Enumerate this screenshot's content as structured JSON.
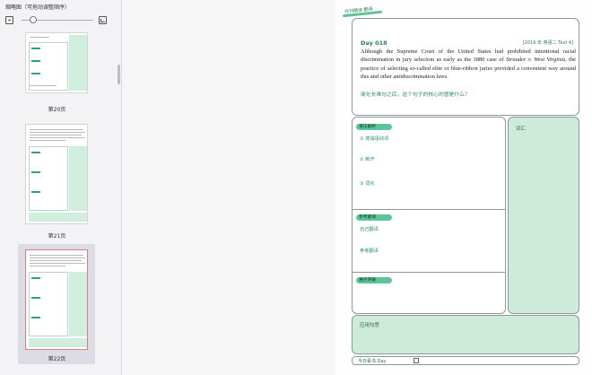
{
  "panel": {
    "title": "缩略图（可拖动调整顺序）"
  },
  "thumbnails": [
    {
      "label": "第20页",
      "selected": false
    },
    {
      "label": "第21页",
      "selected": false
    },
    {
      "label": "第22页",
      "selected": true
    }
  ],
  "document": {
    "logo_text": "外刊精读·翻译",
    "day_label": "Day 018",
    "source": "[2016 年 英语二 Text 4]",
    "english_sentence_parts": [
      "Although the Supreme Court of the United States had prohibited intentional racial discrimination in jury selection as early as the 1880 case of ",
      "Strauder v. West Virginia",
      ", the practice of selecting so-called elite or blue-ribbon juries provided a convenient way around this and other antidiscrimination laws."
    ],
    "question": "简化长难句之后，这个句子的核心的冒是什么？",
    "sections": {
      "analysis_tag": "语法解析",
      "analysis_items": [
        "① 简谓语动词",
        "② 断开",
        "③ 词化"
      ],
      "translation_tag": "参考翻译",
      "own_translation": "自己翻译",
      "reference_translation": "参考翻译",
      "discussion_tag": "难点突破"
    },
    "vocab_label": "词汇",
    "sketch_label": "应用句思",
    "footer_text": "今日看书  Day"
  },
  "colors": {
    "accent": "#5ec59a",
    "accent_dark": "#2f8a6f",
    "panel_green": "#cdeadb",
    "selected_thumb_border": "#e07a86"
  }
}
